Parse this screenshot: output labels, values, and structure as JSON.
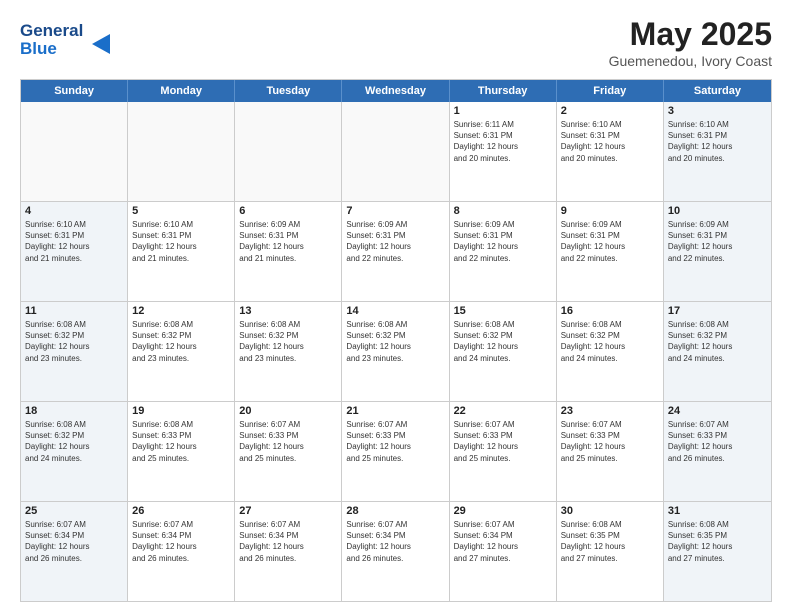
{
  "header": {
    "logo_line1": "General",
    "logo_line2": "Blue",
    "title": "May 2025",
    "subtitle": "Guemenedou, Ivory Coast"
  },
  "weekdays": [
    "Sunday",
    "Monday",
    "Tuesday",
    "Wednesday",
    "Thursday",
    "Friday",
    "Saturday"
  ],
  "weeks": [
    [
      {
        "day": "",
        "info": ""
      },
      {
        "day": "",
        "info": ""
      },
      {
        "day": "",
        "info": ""
      },
      {
        "day": "",
        "info": ""
      },
      {
        "day": "1",
        "info": "Sunrise: 6:11 AM\nSunset: 6:31 PM\nDaylight: 12 hours\nand 20 minutes."
      },
      {
        "day": "2",
        "info": "Sunrise: 6:10 AM\nSunset: 6:31 PM\nDaylight: 12 hours\nand 20 minutes."
      },
      {
        "day": "3",
        "info": "Sunrise: 6:10 AM\nSunset: 6:31 PM\nDaylight: 12 hours\nand 20 minutes."
      }
    ],
    [
      {
        "day": "4",
        "info": "Sunrise: 6:10 AM\nSunset: 6:31 PM\nDaylight: 12 hours\nand 21 minutes."
      },
      {
        "day": "5",
        "info": "Sunrise: 6:10 AM\nSunset: 6:31 PM\nDaylight: 12 hours\nand 21 minutes."
      },
      {
        "day": "6",
        "info": "Sunrise: 6:09 AM\nSunset: 6:31 PM\nDaylight: 12 hours\nand 21 minutes."
      },
      {
        "day": "7",
        "info": "Sunrise: 6:09 AM\nSunset: 6:31 PM\nDaylight: 12 hours\nand 22 minutes."
      },
      {
        "day": "8",
        "info": "Sunrise: 6:09 AM\nSunset: 6:31 PM\nDaylight: 12 hours\nand 22 minutes."
      },
      {
        "day": "9",
        "info": "Sunrise: 6:09 AM\nSunset: 6:31 PM\nDaylight: 12 hours\nand 22 minutes."
      },
      {
        "day": "10",
        "info": "Sunrise: 6:09 AM\nSunset: 6:31 PM\nDaylight: 12 hours\nand 22 minutes."
      }
    ],
    [
      {
        "day": "11",
        "info": "Sunrise: 6:08 AM\nSunset: 6:32 PM\nDaylight: 12 hours\nand 23 minutes."
      },
      {
        "day": "12",
        "info": "Sunrise: 6:08 AM\nSunset: 6:32 PM\nDaylight: 12 hours\nand 23 minutes."
      },
      {
        "day": "13",
        "info": "Sunrise: 6:08 AM\nSunset: 6:32 PM\nDaylight: 12 hours\nand 23 minutes."
      },
      {
        "day": "14",
        "info": "Sunrise: 6:08 AM\nSunset: 6:32 PM\nDaylight: 12 hours\nand 23 minutes."
      },
      {
        "day": "15",
        "info": "Sunrise: 6:08 AM\nSunset: 6:32 PM\nDaylight: 12 hours\nand 24 minutes."
      },
      {
        "day": "16",
        "info": "Sunrise: 6:08 AM\nSunset: 6:32 PM\nDaylight: 12 hours\nand 24 minutes."
      },
      {
        "day": "17",
        "info": "Sunrise: 6:08 AM\nSunset: 6:32 PM\nDaylight: 12 hours\nand 24 minutes."
      }
    ],
    [
      {
        "day": "18",
        "info": "Sunrise: 6:08 AM\nSunset: 6:32 PM\nDaylight: 12 hours\nand 24 minutes."
      },
      {
        "day": "19",
        "info": "Sunrise: 6:08 AM\nSunset: 6:33 PM\nDaylight: 12 hours\nand 25 minutes."
      },
      {
        "day": "20",
        "info": "Sunrise: 6:07 AM\nSunset: 6:33 PM\nDaylight: 12 hours\nand 25 minutes."
      },
      {
        "day": "21",
        "info": "Sunrise: 6:07 AM\nSunset: 6:33 PM\nDaylight: 12 hours\nand 25 minutes."
      },
      {
        "day": "22",
        "info": "Sunrise: 6:07 AM\nSunset: 6:33 PM\nDaylight: 12 hours\nand 25 minutes."
      },
      {
        "day": "23",
        "info": "Sunrise: 6:07 AM\nSunset: 6:33 PM\nDaylight: 12 hours\nand 25 minutes."
      },
      {
        "day": "24",
        "info": "Sunrise: 6:07 AM\nSunset: 6:33 PM\nDaylight: 12 hours\nand 26 minutes."
      }
    ],
    [
      {
        "day": "25",
        "info": "Sunrise: 6:07 AM\nSunset: 6:34 PM\nDaylight: 12 hours\nand 26 minutes."
      },
      {
        "day": "26",
        "info": "Sunrise: 6:07 AM\nSunset: 6:34 PM\nDaylight: 12 hours\nand 26 minutes."
      },
      {
        "day": "27",
        "info": "Sunrise: 6:07 AM\nSunset: 6:34 PM\nDaylight: 12 hours\nand 26 minutes."
      },
      {
        "day": "28",
        "info": "Sunrise: 6:07 AM\nSunset: 6:34 PM\nDaylight: 12 hours\nand 26 minutes."
      },
      {
        "day": "29",
        "info": "Sunrise: 6:07 AM\nSunset: 6:34 PM\nDaylight: 12 hours\nand 27 minutes."
      },
      {
        "day": "30",
        "info": "Sunrise: 6:08 AM\nSunset: 6:35 PM\nDaylight: 12 hours\nand 27 minutes."
      },
      {
        "day": "31",
        "info": "Sunrise: 6:08 AM\nSunset: 6:35 PM\nDaylight: 12 hours\nand 27 minutes."
      }
    ]
  ]
}
